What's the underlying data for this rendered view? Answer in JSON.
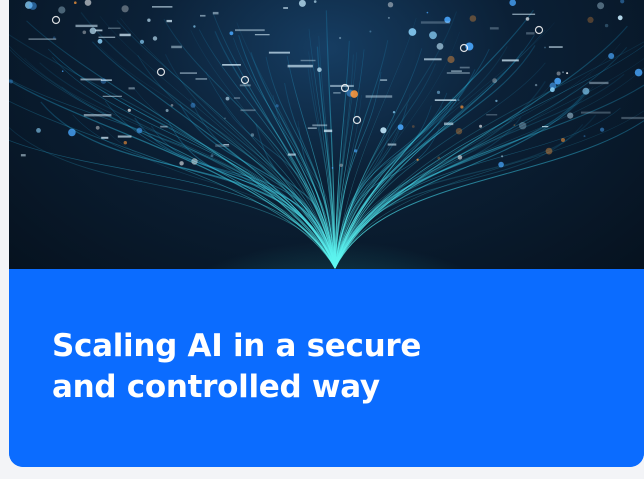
{
  "card": {
    "headline": "Scaling AI in a secure and controlled way",
    "image_subject": "data-network-illustration"
  },
  "colors": {
    "card_blue": "#0b6cff",
    "hero_dark": "#06121f",
    "fiber_cyan": "#2ee6e0",
    "headline_text": "#ffffff"
  }
}
